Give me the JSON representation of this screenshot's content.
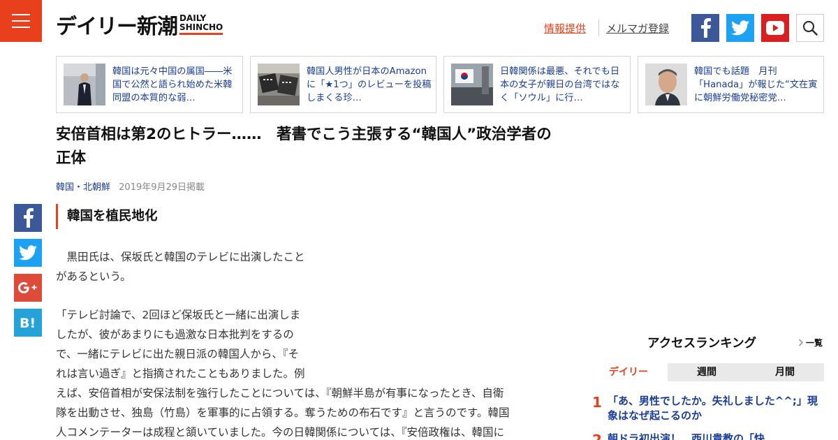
{
  "header": {
    "logo_jp": "デイリー新潮",
    "logo_en_1": "DAILY",
    "logo_en_2": "SHINCHO",
    "link_info": "情報提供",
    "link_mail": "メルマガ登録"
  },
  "related": [
    {
      "text": "韓国は元々中国の属国――米国で公然と語られ始めた米韓同盟の本質的な弱…"
    },
    {
      "text": "韓国人男性が日本のAmazonに「★1つ」のレビューを投稿しまくる珍…"
    },
    {
      "text": "日韓関係は最悪、それでも日本の女子が親日の台湾ではなく「ソウル」に行…"
    },
    {
      "text": "韓国でも話題　月刊「Hanada」が報じた“文在寅に朝鮮労働党秘密党…"
    }
  ],
  "article": {
    "title": "安倍首相は第2のヒトラー……　著書でこう主張する“韓国人”政治学者の正体",
    "category": "韓国・北朝鮮",
    "date": "2019年9月29日掲載",
    "section_heading": "韓国を植民地化",
    "para1_line1": "　黒田氏は、保坂氏と韓国のテレビに出演したこと",
    "para1_line2": "があるという。",
    "para2_line1": "「テレビ討論で、2回ほど保坂氏と一緒に出演しま",
    "para2_line2": "したが、彼があまりにも過激な日本批判をするの",
    "para2_line3": "で、一緒にテレビに出た親日派の韓国人から、『そ",
    "para2_line4": "れは言い過ぎ』と指摘されたこともありました。例",
    "para2_line5": "えば、安倍首相が安保法制を強行したことについては、『朝鮮半島が有事になったとき、自衛",
    "para2_line6": "隊を出動させ、独島（竹島）を軍事的に占領する。奪うための布石です』と言うのです。韓国",
    "para2_line7": "人コメンテーターは成程と頷いていました。今の日韓関係については、『安倍政権は、韓国に"
  },
  "ranking": {
    "title": "アクセスランキング",
    "more": "一覧",
    "tabs": [
      "デイリー",
      "週間",
      "月間"
    ],
    "active_tab": "デイリー",
    "items": [
      {
        "num": "1",
        "text": "「あ、男性でしたか。失礼しました^^;」現象はなぜ起こるのか"
      },
      {
        "num": "2",
        "text": "朝ドラ初出演！　西川貴教の「快"
      }
    ]
  },
  "colors": {
    "accent": "#e8401c",
    "facebook": "#3b5998",
    "twitter": "#1da1f2",
    "youtube": "#d91f1f",
    "googleplus": "#dd4b39",
    "hatena": "#25a3d9",
    "link": "#1a3c9b"
  },
  "icons": [
    "menu-icon",
    "facebook-icon",
    "twitter-icon",
    "youtube-icon",
    "search-icon",
    "googleplus-icon",
    "hatena-bookmark-icon",
    "chevron-right-icon"
  ]
}
